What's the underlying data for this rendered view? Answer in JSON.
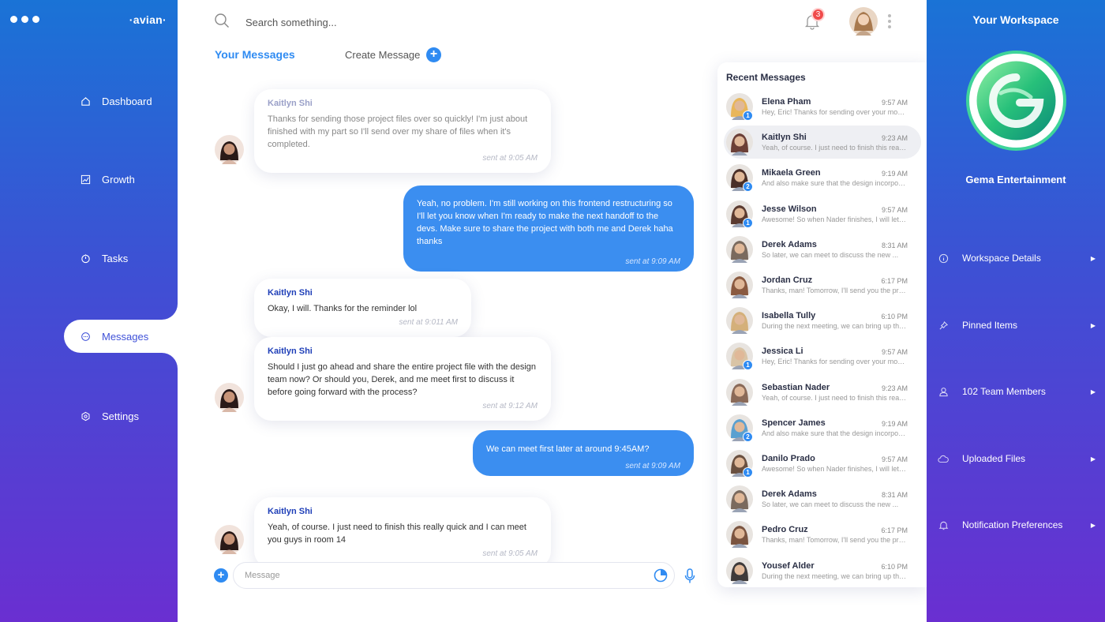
{
  "app": {
    "brand": "·avian·"
  },
  "sidebar": {
    "items": [
      {
        "label": "Dashboard",
        "icon": "home-icon"
      },
      {
        "label": "Growth",
        "icon": "chart-icon"
      },
      {
        "label": "Tasks",
        "icon": "timer-icon"
      },
      {
        "label": "Messages",
        "icon": "chat-icon",
        "active": true
      },
      {
        "label": "Settings",
        "icon": "settings-icon"
      }
    ]
  },
  "header": {
    "search_placeholder": "Search something...",
    "notification_count": "3"
  },
  "tabs": {
    "your_messages": "Your Messages",
    "create_message": "Create Message"
  },
  "messages": [
    {
      "sender": "Kaitlyn Shi",
      "text": "Thanks for sending those project files over so quickly! I'm just about finished with my part so I'll send over my share of files when it's completed.",
      "time": "sent at 9:05 AM"
    },
    {
      "text": "Yeah, no problem. I'm still working on this frontend restructuring so I'll let you know when I'm ready to make the next handoff to the devs. Make sure to share the project with both me and Derek haha thanks",
      "time": "sent at 9:09 AM"
    },
    {
      "sender": "Kaitlyn Shi",
      "text": "Okay, I will. Thanks for the reminder lol",
      "time": "sent at 9:011 AM"
    },
    {
      "sender": "Kaitlyn Shi",
      "text": "Should I just go ahead and share the entire project file with the design team now? Or should you, Derek, and me meet first to discuss it before going forward with the process?",
      "time": "sent at 9:12 AM"
    },
    {
      "text": "We can meet first later at around 9:45AM?",
      "time": "sent at 9:09 AM"
    },
    {
      "sender": "Kaitlyn Shi",
      "text": "Yeah, of course. I just need to finish this really quick and I can meet you guys in room 14",
      "time": "sent at 9:05 AM"
    }
  ],
  "composer": {
    "placeholder": "Message"
  },
  "recent": {
    "title": "Recent Messages",
    "items": [
      {
        "name": "Elena Pham",
        "time": "9:57 AM",
        "preview": "Hey, Eric! Thanks for sending over your mockups",
        "badge": "1",
        "color": "#e8b65a"
      },
      {
        "name": "Kaitlyn Shi",
        "time": "9:23 AM",
        "preview": "Yeah, of course. I just need to finish this really quick",
        "badge": "",
        "color": "#6b3f36",
        "selected": true
      },
      {
        "name": "Mikaela Green",
        "time": "9:19 AM",
        "preview": "And also make sure that the design incorporates",
        "badge": "2",
        "color": "#4a2f28"
      },
      {
        "name": "Jesse Wilson",
        "time": "9:57 AM",
        "preview": "Awesome! So when Nader finishes, I will let you know",
        "badge": "1",
        "color": "#5a3a30"
      },
      {
        "name": "Derek Adams",
        "time": "8:31 AM",
        "preview": "So later, we can meet to discuss the new ...",
        "badge": "",
        "color": "#7a6a5e"
      },
      {
        "name": "Jordan Cruz",
        "time": "6:17 PM",
        "preview": "Thanks, man! Tomorrow, I'll send you the project",
        "badge": "",
        "color": "#8a5a40"
      },
      {
        "name": "Isabella Tully",
        "time": "6:10 PM",
        "preview": "During the next meeting, we can bring up the new",
        "badge": "",
        "color": "#d4b07a"
      },
      {
        "name": "Jessica Li",
        "time": "9:57 AM",
        "preview": "Hey, Eric! Thanks for sending over your mockups",
        "badge": "1",
        "color": "#d9c4a6"
      },
      {
        "name": "Sebastian Nader",
        "time": "9:23 AM",
        "preview": "Yeah, of course. I just need to finish this really quick",
        "badge": "",
        "color": "#8a6a58"
      },
      {
        "name": "Spencer James",
        "time": "9:19 AM",
        "preview": "And also make sure that the design incorporates",
        "badge": "2",
        "color": "#5aa0d0"
      },
      {
        "name": "Danilo Prado",
        "time": "9:57 AM",
        "preview": "Awesome! So when Nader finishes, I will let you know",
        "badge": "1",
        "color": "#6a5040"
      },
      {
        "name": "Derek Adams",
        "time": "8:31 AM",
        "preview": "So later, we can meet to discuss the new ...",
        "badge": "",
        "color": "#7a6a5e"
      },
      {
        "name": "Pedro Cruz",
        "time": "6:17 PM",
        "preview": "Thanks, man! Tomorrow, I'll send you the project",
        "badge": "",
        "color": "#7a5440"
      },
      {
        "name": "Yousef Alder",
        "time": "6:10 PM",
        "preview": "During the next meeting, we can bring up the new",
        "badge": "",
        "color": "#3e3a3a"
      }
    ]
  },
  "workspace": {
    "title": "Your Workspace",
    "name": "Gema Entertainment",
    "items": [
      {
        "label": "Workspace Details",
        "icon": "info-icon"
      },
      {
        "label": "Pinned Items",
        "icon": "pin-icon"
      },
      {
        "label": "102 Team Members",
        "icon": "user-icon"
      },
      {
        "label": "Uploaded Files",
        "icon": "cloud-icon"
      },
      {
        "label": "Notification Preferences",
        "icon": "bell-icon"
      }
    ]
  },
  "colors": {
    "accent": "#2f8bf2",
    "sidebar_top": "#1a73d6",
    "sidebar_bottom": "#6a2fd1",
    "badge": "#f04a4a"
  }
}
